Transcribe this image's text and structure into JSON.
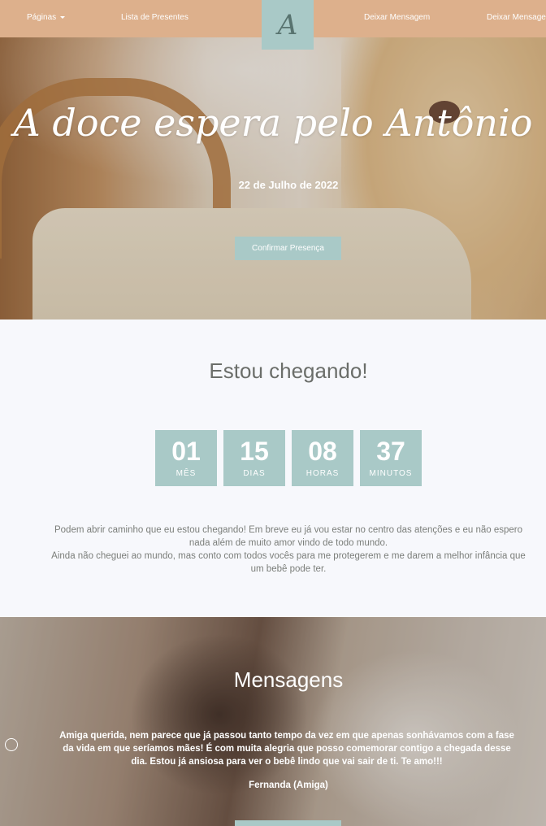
{
  "nav": {
    "pages_label": "Páginas",
    "gift_list_label": "Lista de Presentes",
    "logo_letter": "A",
    "leave_message_label": "Deixar Mensagem",
    "leave_message_label_2": "Deixar Mensagem"
  },
  "hero": {
    "title": "A doce espera pelo Antônio",
    "date": "22 de Julho de 2022",
    "confirm_button": "Confirmar Presença"
  },
  "countdown": {
    "title": "Estou chegando!",
    "items": [
      {
        "value": "01",
        "label": "MÊS"
      },
      {
        "value": "15",
        "label": "DIAS"
      },
      {
        "value": "08",
        "label": "HORAS"
      },
      {
        "value": "37",
        "label": "MINUTOS"
      }
    ],
    "paragraph_1": "Podem abrir caminho que eu estou chegando! Em breve eu já vou estar no centro das atenções e eu não espero nada além de muito amor vindo de todo mundo.",
    "paragraph_2": "Ainda não cheguei ao mundo, mas conto com todos vocês para me protegerem e me darem a melhor infância que um bebê pode ter."
  },
  "messages": {
    "title": "Mensagens",
    "text": "Amiga querida, nem parece que já passou tanto tempo da vez em que apenas sonhávamos com a fase da vida em que seríamos mães! É com muita alegria que posso comemorar contigo a chegada desse dia. Estou já ansiosa para ver o bebê lindo que vai sair de ti. Te amo!!!",
    "author": "Fernanda (Amiga)"
  },
  "colors": {
    "nav_bg": "#ddb08c",
    "accent": "#a9c9c7",
    "section_bg": "#f7f8fc"
  }
}
